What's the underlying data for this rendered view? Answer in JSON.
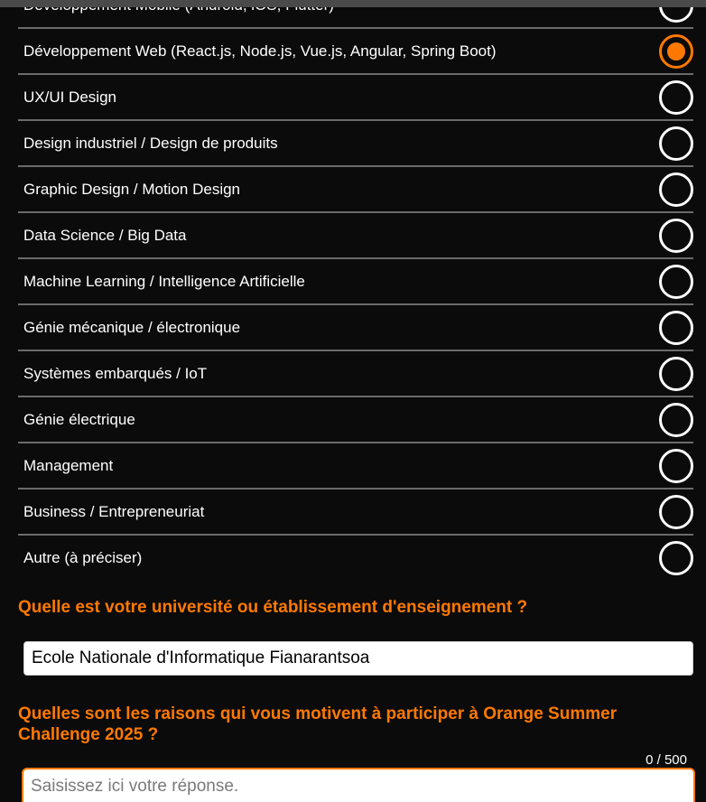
{
  "form": {
    "options": [
      {
        "label": "Développement Mobile (Android, iOS, Flutter)",
        "checked": false
      },
      {
        "label": "Développement Web (React.js, Node.js, Vue.js, Angular, Spring Boot)",
        "checked": true
      },
      {
        "label": "UX/UI Design",
        "checked": false
      },
      {
        "label": "Design industriel / Design de produits",
        "checked": false
      },
      {
        "label": "Graphic Design / Motion Design",
        "checked": false
      },
      {
        "label": "Data Science / Big Data",
        "checked": false
      },
      {
        "label": "Machine Learning / Intelligence Artificielle",
        "checked": false
      },
      {
        "label": "Génie mécanique / électronique",
        "checked": false
      },
      {
        "label": "Systèmes embarqués / IoT",
        "checked": false
      },
      {
        "label": "Génie électrique",
        "checked": false
      },
      {
        "label": "Management",
        "checked": false
      },
      {
        "label": "Business / Entrepreneuriat",
        "checked": false
      },
      {
        "label": "Autre (à préciser)",
        "checked": false
      }
    ],
    "university_question": "Quelle est votre université ou établissement d'enseignement ?",
    "university_value": "Ecole Nationale d'Informatique Fianarantsoa",
    "motivation_question": "Quelles sont les raisons qui vous motivent à participer à Orange Summer Challenge 2025 ?",
    "motivation_counter": "0 / 500",
    "motivation_placeholder": "Saisissez ici votre réponse.",
    "motivation_value": ""
  },
  "colors": {
    "accent": "#ff7900",
    "background": "#0b0b0b",
    "divider": "#6b6b6b"
  }
}
